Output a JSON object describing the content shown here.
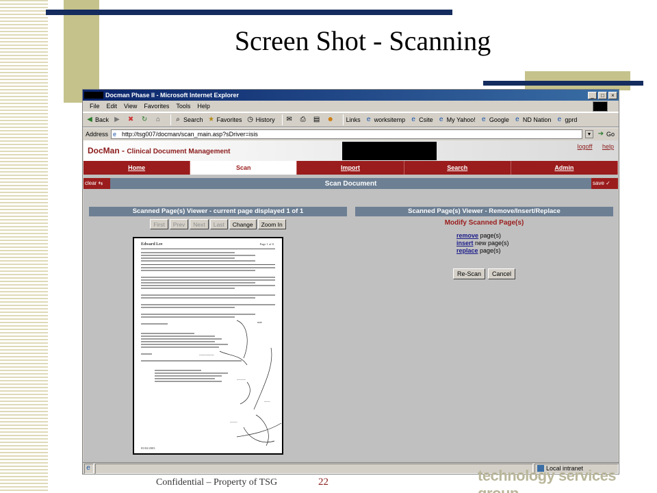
{
  "slide": {
    "title": "Screen Shot - Scanning",
    "footer": "Confidential – Property of TSG",
    "page_number": "22",
    "brand": "technology services group"
  },
  "browser": {
    "title": "Docman Phase II - Microsoft Internet Explorer",
    "menu": [
      "File",
      "Edit",
      "View",
      "Favorites",
      "Tools",
      "Help"
    ],
    "toolbar": {
      "back": "Back",
      "search": "Search",
      "favorites": "Favorites",
      "history": "History",
      "links_label": "Links",
      "links": [
        "worksitemp",
        "Csite",
        "My Yahoo!",
        "Google",
        "ND Nation",
        "gprd"
      ]
    },
    "address_label": "Address",
    "address_value": "http://tsg007/docman/scan_main.asp?sDriver=isis",
    "go_label": "Go",
    "status_zone": "Local intranet"
  },
  "app": {
    "title": "DocMan - ",
    "subtitle": "Clinical Document Management",
    "header_links": [
      "logoff",
      "help"
    ],
    "nav": [
      "Home",
      "Scan",
      "Import",
      "Search",
      "Admin"
    ],
    "active_tab": "Scan",
    "clear_label": "clear",
    "save_label": "save",
    "section_title": "Scan Document",
    "left_panel": {
      "title": "Scanned Page(s) Viewer - current page displayed 1 of 1",
      "pager": [
        "First",
        "Prev",
        "Next",
        "Last"
      ],
      "change_label": "Change",
      "zoom_label": "Zoom In",
      "doc": {
        "page": "Page 1 of 6",
        "name": "Edward Lee",
        "date": "05/02/2003"
      }
    },
    "right_panel": {
      "title": "Scanned Page(s) Viewer - Remove/Insert/Replace",
      "heading": "Modify Scanned Page(s)",
      "actions": [
        {
          "link": "remove",
          "rest": " page(s)"
        },
        {
          "link": "insert",
          "rest": " new page(s)"
        },
        {
          "link": "replace",
          "rest": " page(s)"
        }
      ],
      "rescan_label": "Re-Scan",
      "cancel_label": "Cancel"
    }
  }
}
